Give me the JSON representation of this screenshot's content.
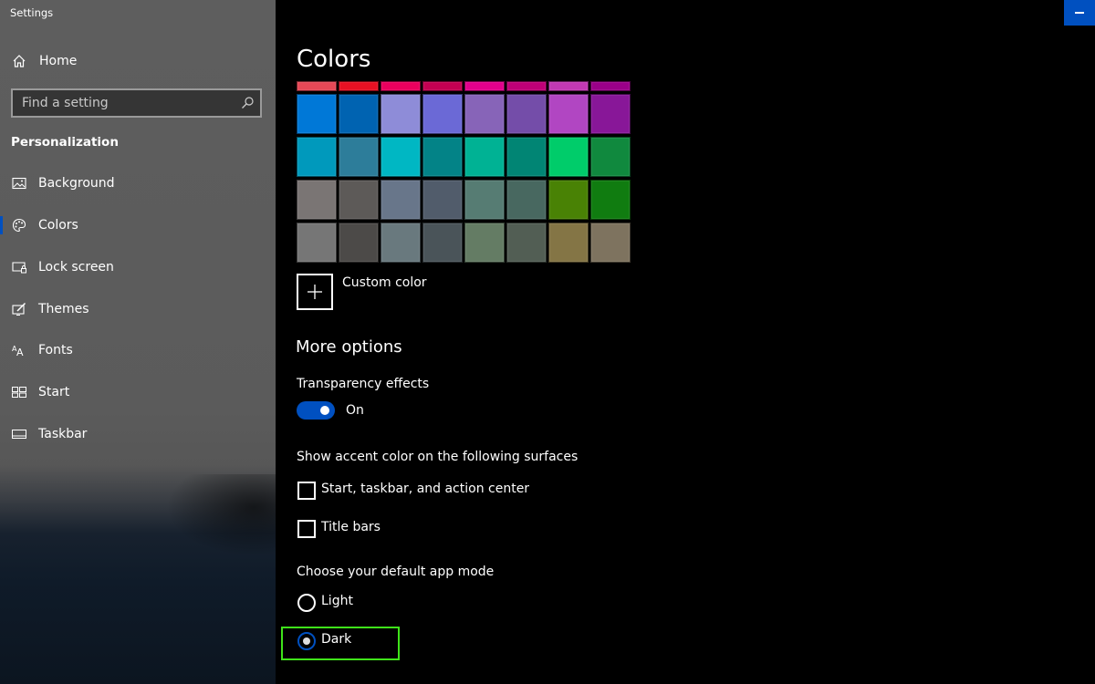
{
  "window": {
    "title": "Settings"
  },
  "sidebar": {
    "home_label": "Home",
    "search_placeholder": "Find a setting",
    "section_title": "Personalization",
    "items": [
      {
        "label": "Background",
        "icon": "image-icon"
      },
      {
        "label": "Colors",
        "icon": "palette-icon",
        "active": true
      },
      {
        "label": "Lock screen",
        "icon": "lock-screen-icon"
      },
      {
        "label": "Themes",
        "icon": "themes-icon"
      },
      {
        "label": "Fonts",
        "icon": "fonts-icon"
      },
      {
        "label": "Start",
        "icon": "start-icon"
      },
      {
        "label": "Taskbar",
        "icon": "taskbar-icon"
      }
    ]
  },
  "main": {
    "title": "Colors",
    "swatches": {
      "top_row": [
        "#e74856",
        "#e81123",
        "#ea005e",
        "#c30052",
        "#e3008c",
        "#bf0077",
        "#c239b3",
        "#9a0089"
      ],
      "rows": [
        [
          "#0078d7",
          "#0063b1",
          "#8e8cd8",
          "#6b69d6",
          "#8764b8",
          "#744da9",
          "#b146c2",
          "#881798"
        ],
        [
          "#0099bc",
          "#2d7d9a",
          "#00b7c3",
          "#038387",
          "#00b294",
          "#018574",
          "#00cc6a",
          "#10893e"
        ],
        [
          "#7a7574",
          "#5d5a58",
          "#68768a",
          "#515c6b",
          "#567c73",
          "#486860",
          "#498205",
          "#107c10"
        ],
        [
          "#767676",
          "#4c4a48",
          "#69797e",
          "#4a5459",
          "#647c64",
          "#525e54",
          "#847545",
          "#7e735f"
        ]
      ]
    },
    "custom_color_label": "Custom color",
    "more_options_heading": "More options",
    "transparency": {
      "label": "Transparency effects",
      "state_label": "On",
      "on": true
    },
    "accent_surfaces": {
      "label": "Show accent color on the following surfaces",
      "options": [
        {
          "label": "Start, taskbar, and action center",
          "checked": false
        },
        {
          "label": "Title bars",
          "checked": false
        }
      ]
    },
    "app_mode": {
      "label": "Choose your default app mode",
      "options": [
        {
          "label": "Light",
          "selected": false
        },
        {
          "label": "Dark",
          "selected": true
        }
      ]
    }
  },
  "colors": {
    "accent": "#0050c0",
    "highlight": "#3fe31a"
  }
}
